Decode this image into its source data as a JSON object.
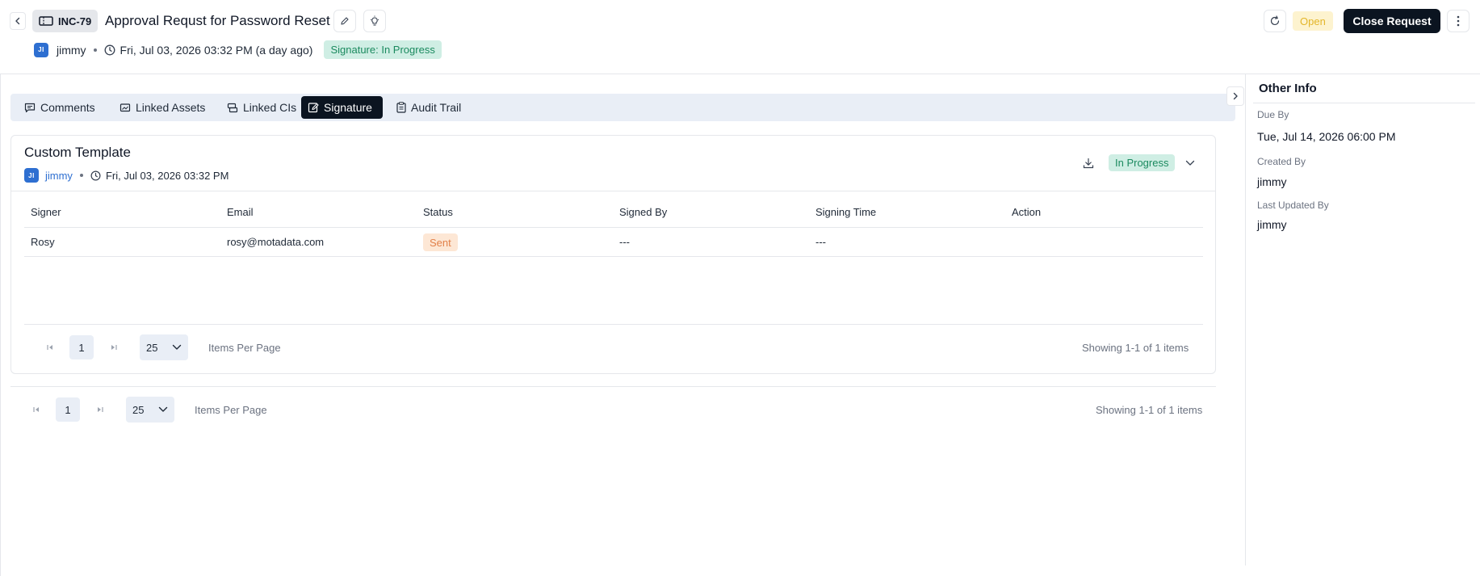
{
  "header": {
    "ticket_id": "INC-79",
    "title": "Approval Requst for Password Reset",
    "user_initials": "JI",
    "user_name": "jimmy",
    "created_at": "Fri, Jul 03, 2026 03:32 PM (a day ago)",
    "signature_status": "Signature: In Progress",
    "status": "Open",
    "close_button_label": "Close Request"
  },
  "tabs": [
    {
      "label": "Comments",
      "icon": "comment-icon"
    },
    {
      "label": "Linked Assets",
      "icon": "asset-icon"
    },
    {
      "label": "Linked CIs",
      "icon": "ci-icon"
    },
    {
      "label": "Signature",
      "icon": "signature-icon",
      "active": true
    },
    {
      "label": "Audit Trail",
      "icon": "clipboard-icon"
    }
  ],
  "template_card": {
    "title": "Custom Template",
    "user_initials": "JI",
    "user_name": "jimmy",
    "created_at": "Fri, Jul 03, 2026 03:32 PM",
    "status": "In Progress",
    "columns": [
      "Signer",
      "Email",
      "Status",
      "Signed By",
      "Signing Time",
      "Action"
    ],
    "rows": [
      {
        "signer": "Rosy",
        "email": "rosy@motadata.com",
        "status": "Sent",
        "signed_by": "---",
        "signing_time": "---",
        "action": ""
      }
    ],
    "pagination": {
      "page": "1",
      "per_page": "25",
      "per_page_label": "Items Per Page",
      "showing": "Showing 1-1 of 1 items"
    }
  },
  "outer_pagination": {
    "page": "1",
    "per_page": "25",
    "per_page_label": "Items Per Page",
    "showing": "Showing 1-1 of 1 items"
  },
  "other_info": {
    "title": "Other Info",
    "due_by_label": "Due By",
    "due_by": "Tue, Jul 14, 2026 06:00 PM",
    "created_by_label": "Created By",
    "created_by": "jimmy",
    "last_updated_by_label": "Last Updated By",
    "last_updated_by": "jimmy"
  },
  "colors": {
    "accent_dark": "#0b1420",
    "success_bg": "#cfeee4",
    "success_text": "#1b8a5f",
    "warning_bg": "#fdf3cf",
    "warning_text": "#e3b62b",
    "sent_bg": "#fde7d5",
    "sent_text": "#e2814a",
    "avatar": "#2e6fd1"
  }
}
